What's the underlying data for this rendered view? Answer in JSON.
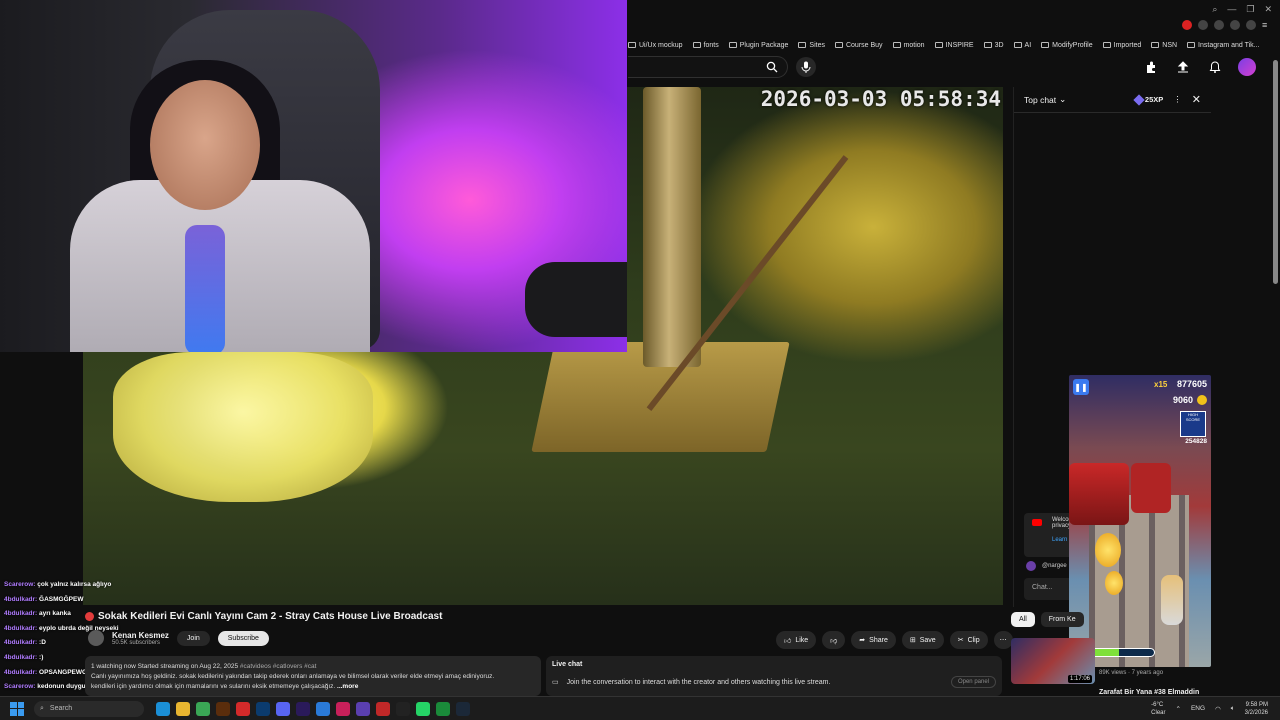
{
  "browser": {
    "bookmarks": [
      "Ui/Ux mockup",
      "fonts",
      "Plugin Package",
      "Sites",
      "Course Buy",
      "motion",
      "INSPIRE",
      "3D",
      "AI",
      "ModifyProfile",
      "Imported",
      "NSN",
      "Instagram and Tik..."
    ]
  },
  "video": {
    "timestamp": "2026-03-03 05:58:34",
    "title": "Sokak Kedileri Evi Canlı Yayını Cam 2 - Stray Cats House Live Broadcast",
    "channel": "Kenan Kesmez",
    "subscribers": "50.5K subscribers",
    "join_label": "Join",
    "subscribe_label": "Subscribe",
    "like_label": "Like",
    "share_label": "Share",
    "save_label": "Save",
    "clip_label": "Clip",
    "desc_stats": "1 watching now  Started streaming on Aug 22, 2025 ",
    "desc_tags": "#catvideos #catlovers #cat",
    "desc_line2": "Canlı yayınımıza hoş geldiniz. sokak kedilerini yakından takip ederek onları anlamaya ve bilimsel olarak veriler elde etmeyi amaç ediniyoruz.",
    "desc_line3": "kendileri için yardımcı olmak için mamalarını ve sularını eksik etmemeye çalışacağız.",
    "more_label": "...more"
  },
  "livechat_box": {
    "title": "Live chat",
    "text": "Join the conversation to interact with the creator and others watching this live stream.",
    "open_panel": "Open panel"
  },
  "stream_chat": [
    {
      "user": "Scarerow:",
      "msg": "çok yalnız kalırsa ağlıyo"
    },
    {
      "user": "4bdulkadr:",
      "msg": "ĞASMGĞPEW"
    },
    {
      "user": "4bdulkadr:",
      "msg": "ayrı kanka"
    },
    {
      "user": "4bdulkadr:",
      "msg": "eyplo ubrda değil neyseki"
    },
    {
      "user": "4bdulkadr:",
      "msg": ":D"
    },
    {
      "user": "4bdulkadr:",
      "msg": ":)"
    },
    {
      "user": "4bdulkadr:",
      "msg": "OPSANGPEWGWE"
    },
    {
      "user": "Scarerow:",
      "msg": "kedonun duygularını önemseyenler var"
    }
  ],
  "top_chat": {
    "title": "Top chat",
    "xp": "25XP",
    "welcome_text": "Welcome privacy",
    "learn_label": "Learn",
    "user": "@nargee",
    "input_placeholder": "Chat..."
  },
  "game": {
    "multiplier": "x15",
    "score": "877605",
    "coins": "9060",
    "highscore_label": "HIGH SCORE",
    "highscore": "254828",
    "magnet_level": 0.55
  },
  "filters": {
    "all": "All",
    "from": "From Ke"
  },
  "recommendation": {
    "duration": "1:17:06",
    "meta": "89K views · 7 years ago",
    "title": "Zarafat Bir Yana #38 Elmaddin"
  },
  "taskbar": {
    "search": "Search",
    "temp": "-6°C",
    "weather": "Clear",
    "lang": "ENG",
    "time": "9:58 PM",
    "date": "3/2/2026"
  },
  "colors": {
    "accent": "#3ea6ff",
    "live": "#e23c3c",
    "chat_user": "#b07cff"
  }
}
